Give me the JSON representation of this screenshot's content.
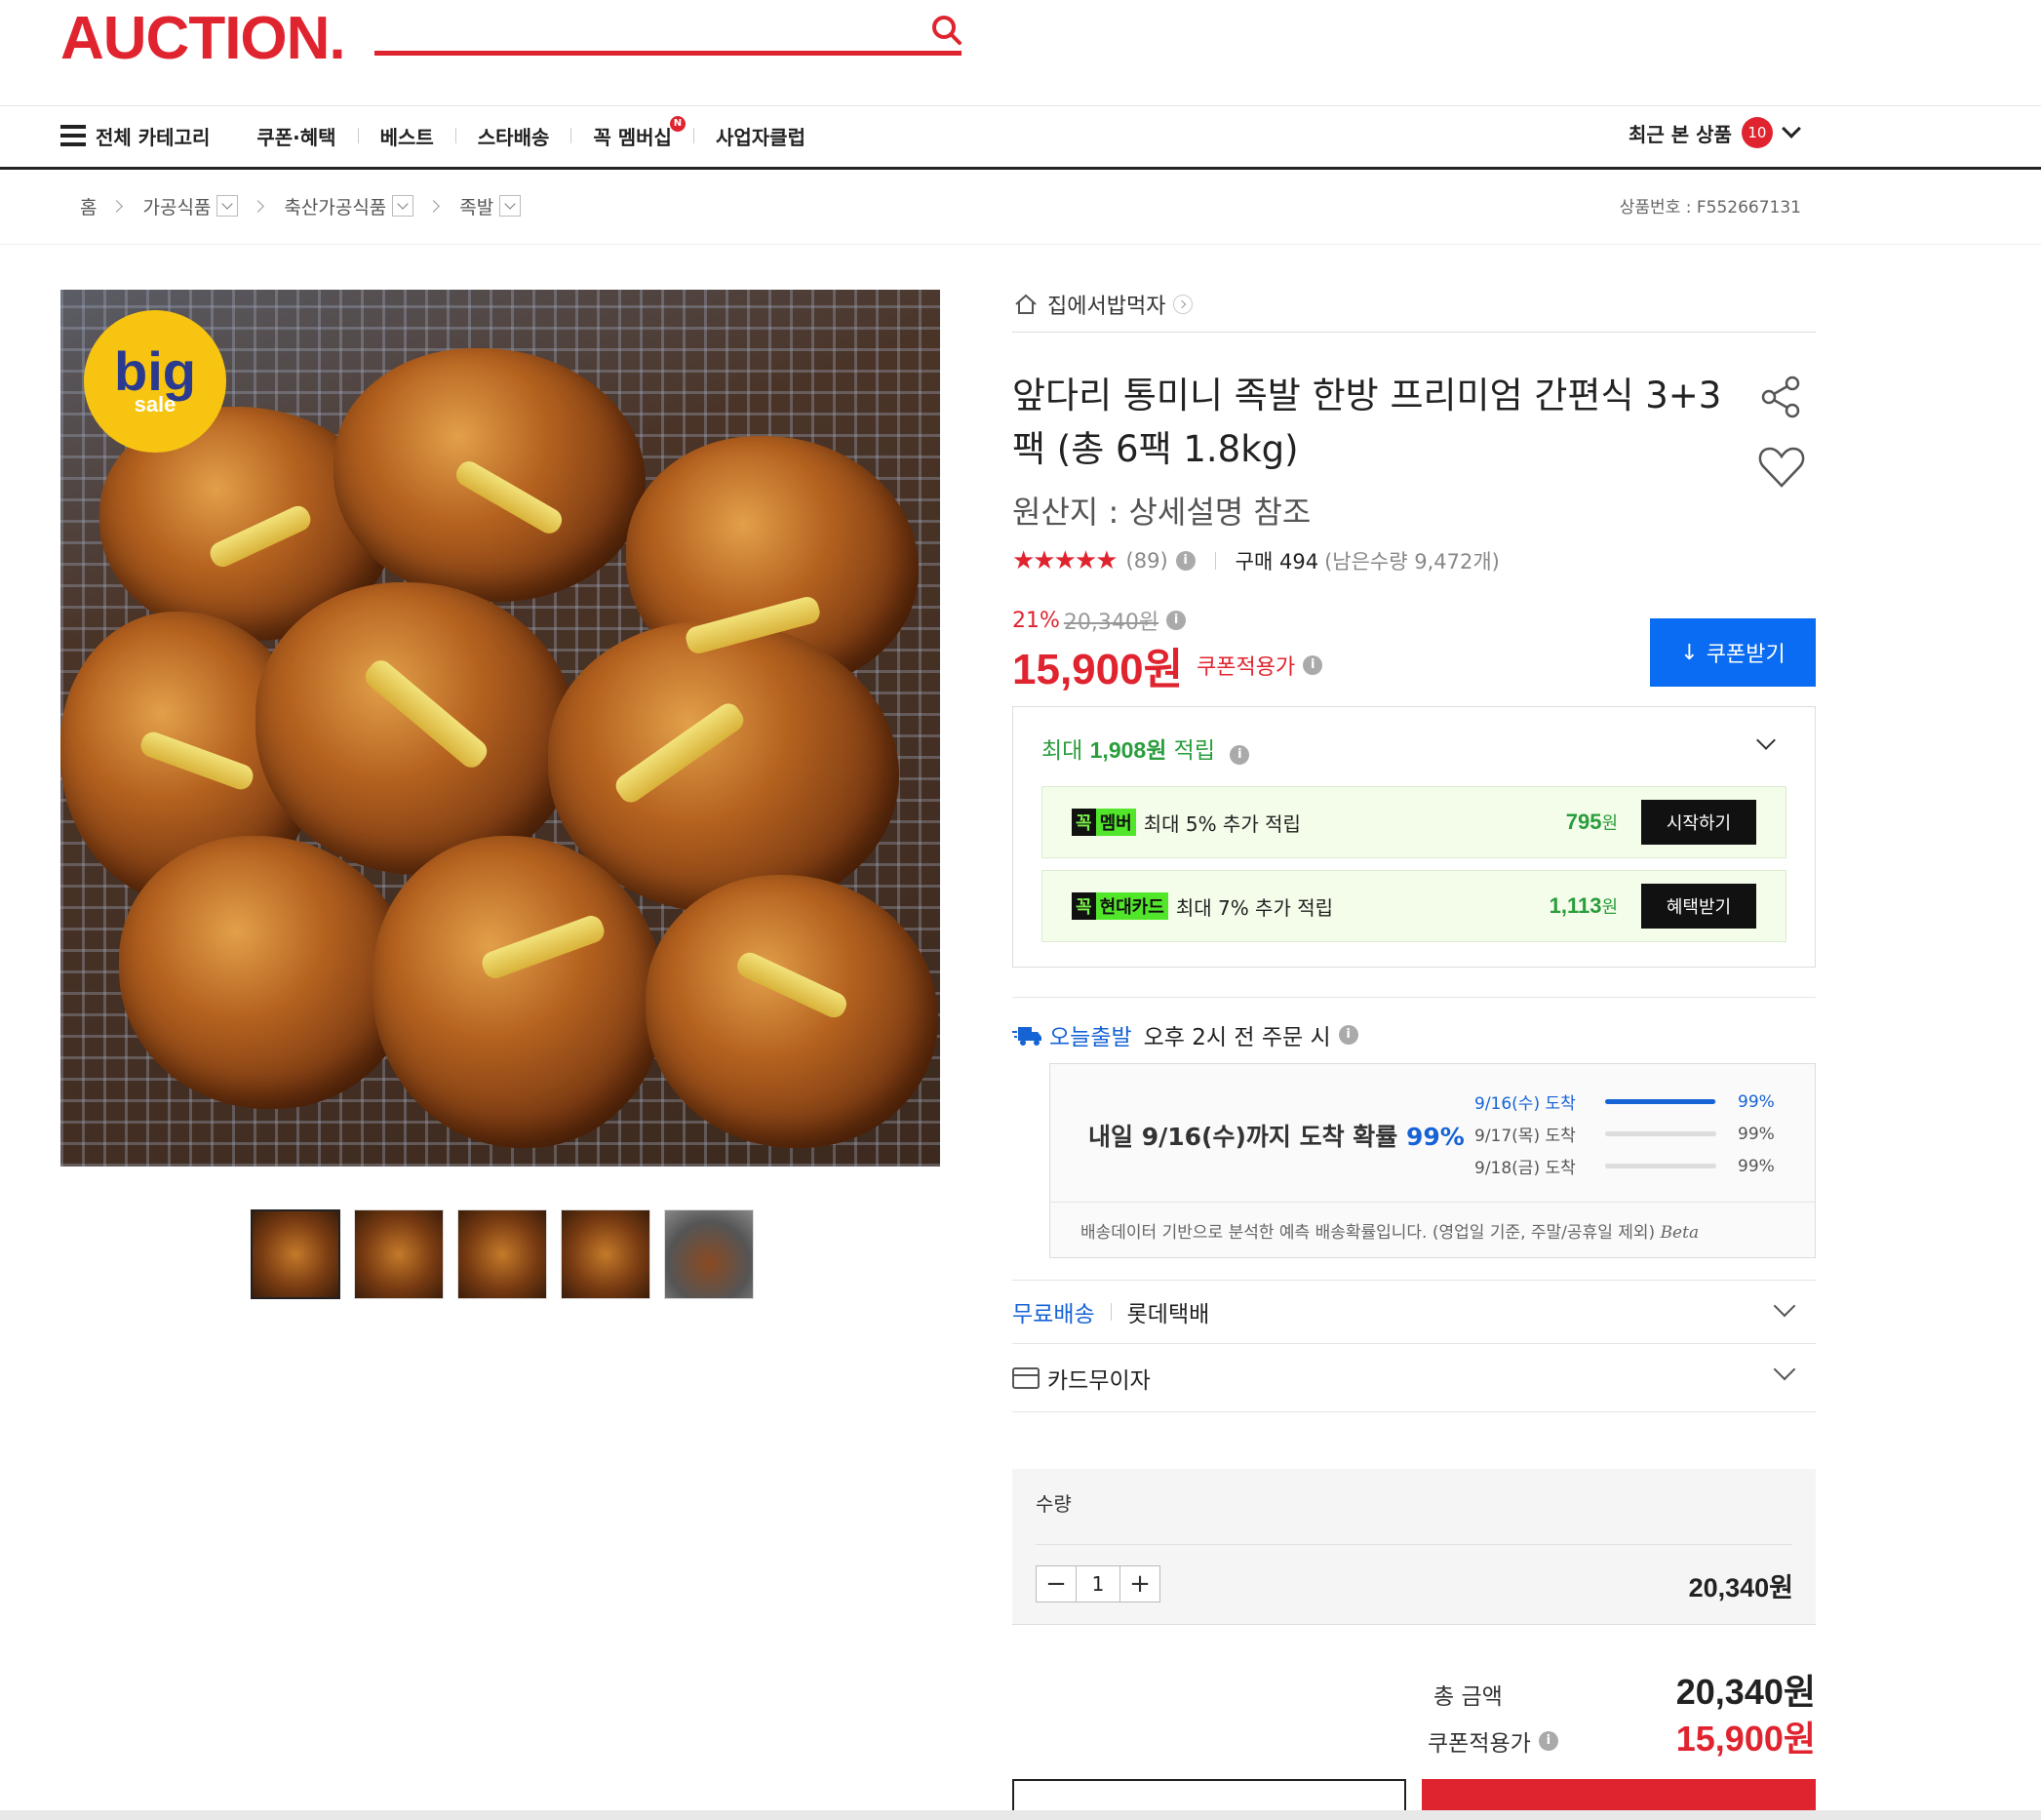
{
  "header": {
    "logo": "AUCTION.",
    "nav": {
      "all_categories": "전체 카테고리",
      "items": [
        "쿠폰·혜택",
        "베스트",
        "스타배송",
        "꼭 멤버십",
        "사업자클럽"
      ],
      "new_badge": "N",
      "recent_label": "최근 본 상품",
      "recent_count": "10"
    }
  },
  "breadcrumb": {
    "home": "홈",
    "items": [
      "가공식품",
      "축산가공식품",
      "족발"
    ],
    "product_no": "상품번호 : F552667131"
  },
  "gallery": {
    "badge_big": "big",
    "badge_sale": "sale",
    "thumb_count": 5
  },
  "product": {
    "seller": "집에서밥먹자",
    "title": "앞다리 통미니 족발 한방 프리미엄 간편식 3+3팩 (총 6팩 1.8kg)",
    "origin": "원산지 : 상세설명 참조",
    "rating": 4.5,
    "stars": "★★★★★",
    "review_count": "(89)",
    "purchase": "구매 494",
    "remaining": "(남은수량 9,472개)",
    "discount_pct": "21%",
    "original_price": "20,340원",
    "price": "15,900원",
    "price_label": "쿠폰적용가",
    "coupon_button": "쿠폰받기"
  },
  "rewards": {
    "title_prefix": "최대 ",
    "title_amount": "1,908원",
    "title_suffix": " 적립",
    "rows": [
      {
        "tag_k": "꼭",
        "tag_v": "멤버",
        "text": "최대 5% 추가 적립",
        "amount": "795",
        "unit": "원",
        "button": "시작하기"
      },
      {
        "tag_k": "꼭",
        "tag_v": "현대카드",
        "text": "최대 7% 추가 적립",
        "amount": "1,113",
        "unit": "원",
        "button": "혜택받기"
      }
    ]
  },
  "shipping": {
    "today_label": "오늘출발",
    "today_text": "오후 2시 전 주문 시",
    "arrival_main": "내일 9/16(수)까지 도착 확률 ",
    "arrival_pct": "99%",
    "rows": [
      {
        "date": "9/16(수) 도착",
        "pct": "99%",
        "value": 0.99
      },
      {
        "date": "9/17(목) 도착",
        "pct": "99%",
        "value": 0
      },
      {
        "date": "9/18(금) 도착",
        "pct": "99%",
        "value": 0
      }
    ],
    "note": "배송데이터 기반으로 분석한 예측 배송확률입니다. (영업일 기준, 주말/공휴일 제외)",
    "beta": "Beta",
    "free_shipping": "무료배송",
    "carrier": "롯데택배",
    "card_installment": "카드무이자"
  },
  "order": {
    "qty_label": "수량",
    "qty_value": "1",
    "minus": "−",
    "plus": "+",
    "qty_price": "20,340원",
    "total_label": "총 금액",
    "total_value": "20,340원",
    "coupon_total_label": "쿠폰적용가",
    "coupon_total_value": "15,900원"
  },
  "colors": {
    "brand": "#e0242f",
    "accent_blue": "#0a6cf2",
    "reward_green": "#2a9d3c"
  }
}
